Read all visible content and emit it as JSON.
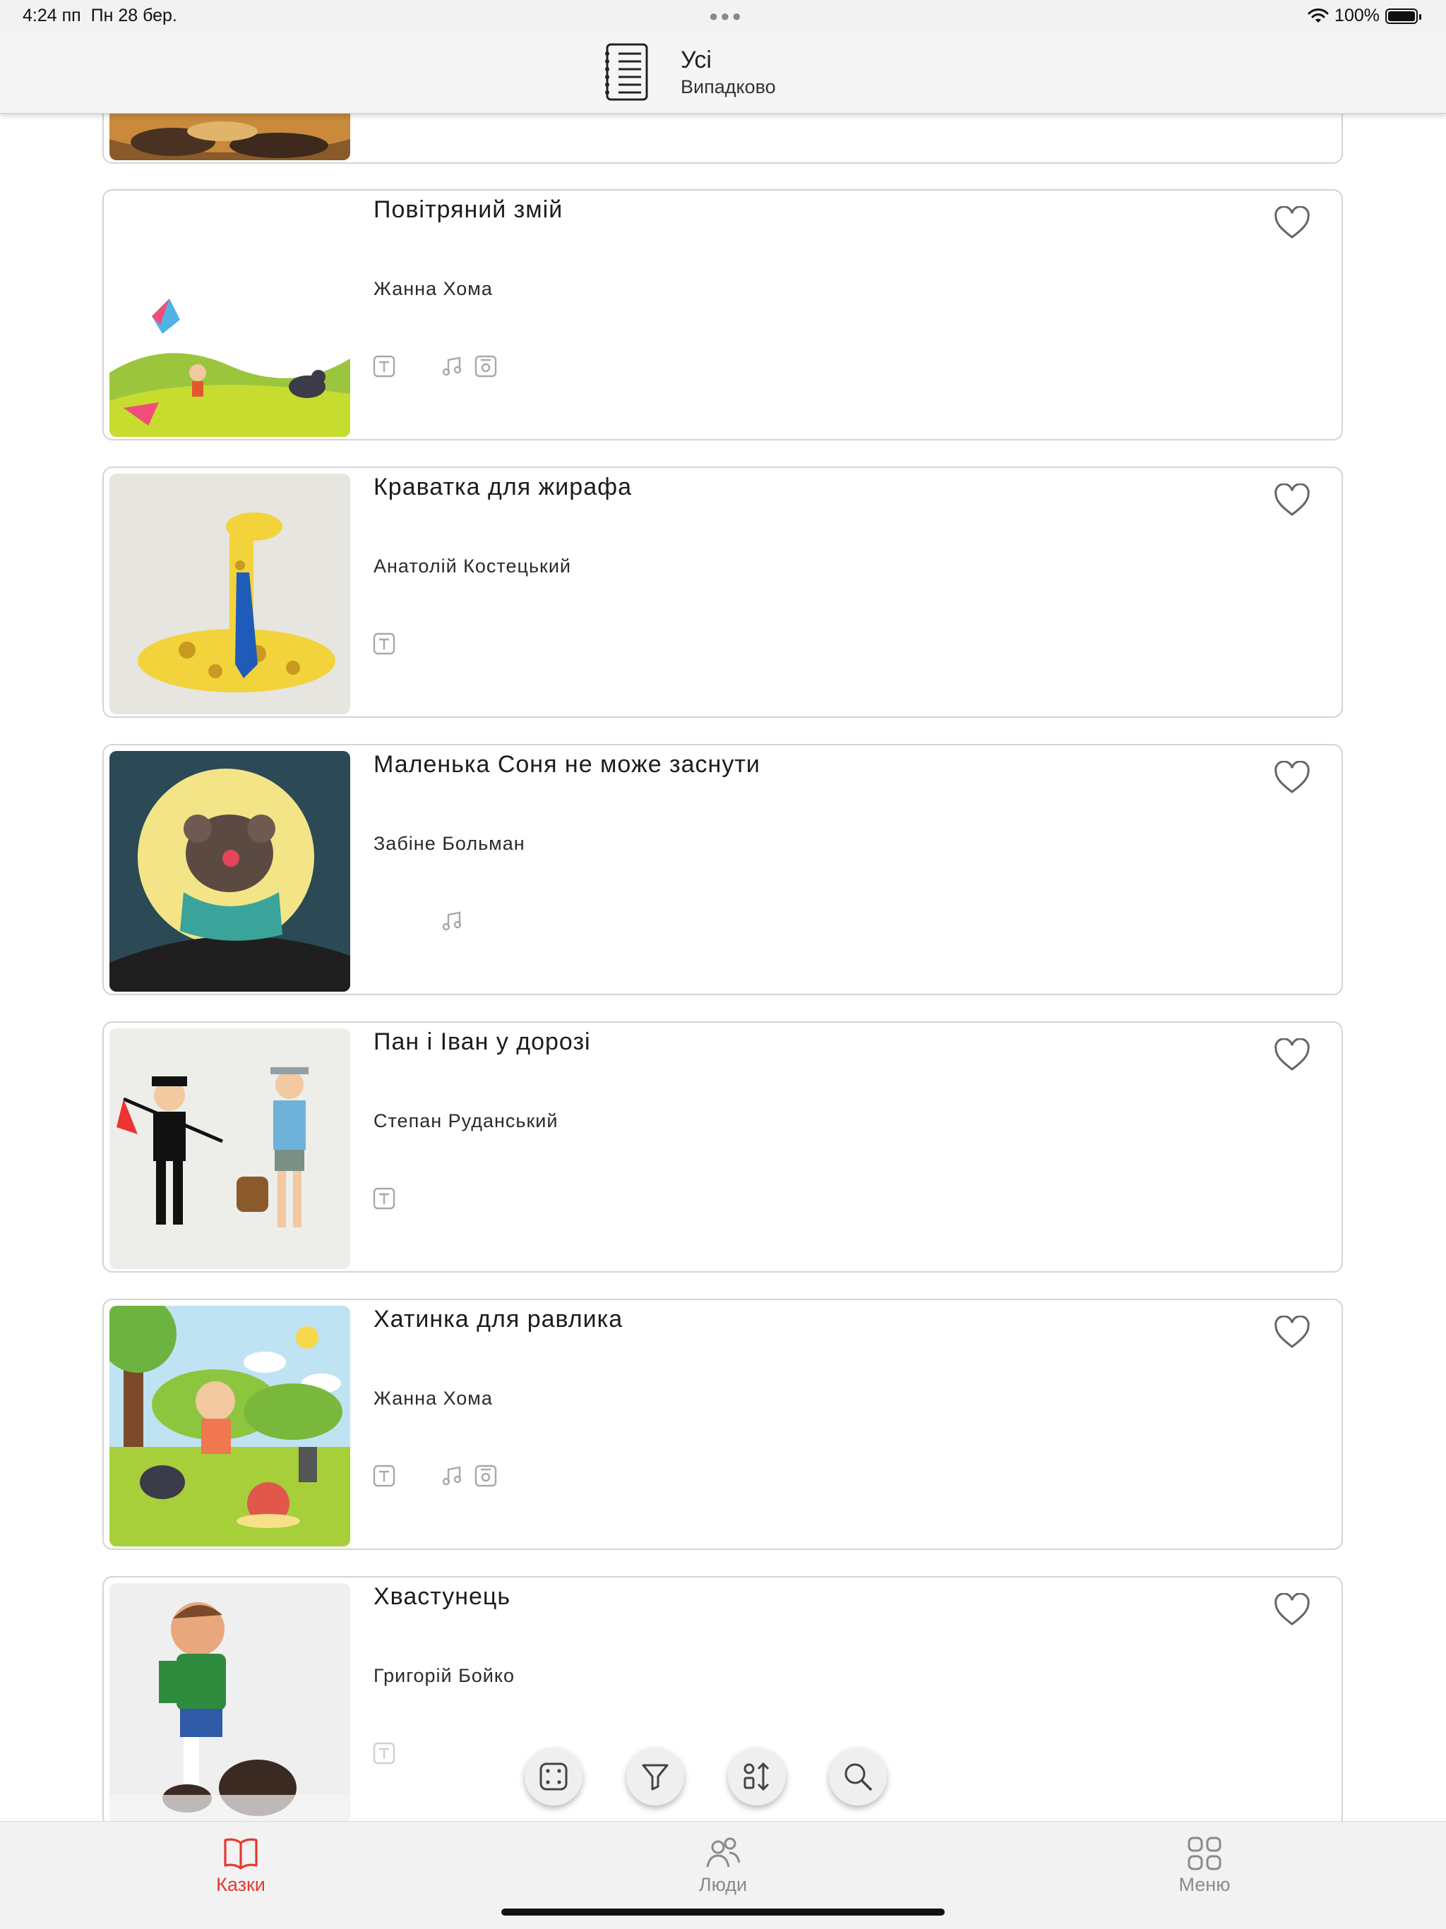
{
  "status_bar": {
    "time": "4:24 пп",
    "date": "Пн 28 бер.",
    "battery": "100%"
  },
  "header": {
    "title": "Усі",
    "subtitle": "Випадково",
    "icon": "list-icon"
  },
  "stories": [
    {
      "title": "",
      "author": "",
      "partial": true
    },
    {
      "title": "Повітряний змій",
      "author": "Жанна Хома",
      "formats": [
        "text",
        "audio",
        "video"
      ],
      "favorite": false
    },
    {
      "title": "Краватка для жирафа",
      "author": "Анатолій Костецький",
      "formats": [
        "text"
      ],
      "favorite": false
    },
    {
      "title": "Маленька Соня не може заснути",
      "author": "Забіне Больман",
      "formats": [
        "audio"
      ],
      "favorite": false
    },
    {
      "title": "Пан і Іван у дорозі",
      "author": "Степан Руданський",
      "formats": [
        "text"
      ],
      "favorite": false
    },
    {
      "title": "Хатинка для равлика",
      "author": "Жанна Хома",
      "formats": [
        "text",
        "audio",
        "video"
      ],
      "favorite": false
    },
    {
      "title": "Хвастунець",
      "author": "Григорій Бойко",
      "formats": [
        "text"
      ],
      "favorite": false
    }
  ],
  "toolbar": {
    "buttons": [
      "random-icon",
      "filter-icon",
      "sort-icon",
      "search-icon"
    ]
  },
  "tabs": [
    {
      "label": "Казки",
      "icon": "book-icon",
      "active": true
    },
    {
      "label": "Люди",
      "icon": "people-icon",
      "active": false
    },
    {
      "label": "Меню",
      "icon": "grid-icon",
      "active": false
    }
  ],
  "colors": {
    "accent": "#e53935",
    "inactive": "#8a8a8a",
    "card_border": "#d4d4d4"
  }
}
